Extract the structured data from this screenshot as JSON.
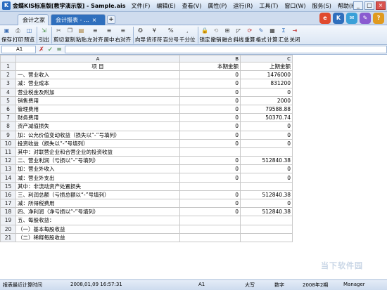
{
  "title": "金蝶KIS标准版[教学演示版] - Sample.ais",
  "menu": [
    "文件(F)",
    "编辑(E)",
    "查看(V)",
    "属性(P)",
    "运行(R)",
    "工具(T)",
    "窗口(W)",
    "服务(S)",
    "帮助(H)"
  ],
  "tabs": [
    {
      "label": "会计之家"
    },
    {
      "label": "会计报表 - ..."
    }
  ],
  "tab_close": "×",
  "tab_add": "+",
  "window_buttons": {
    "min": "_",
    "max": "□",
    "close": "×"
  },
  "skins": [
    {
      "text": "e",
      "color": "#e04a2f"
    },
    {
      "text": "K",
      "color": "#2f6fbd"
    },
    {
      "text": "✉",
      "color": "#3aa0d8"
    },
    {
      "text": "✎",
      "color": "#8a5bd0"
    },
    {
      "text": "?",
      "color": "#e09a1f"
    }
  ],
  "toolbar": [
    {
      "label": "保存",
      "icon": "save-icon",
      "glyph": "▣",
      "color": "#3b6db3"
    },
    {
      "label": "打印",
      "icon": "print-icon",
      "glyph": "⎙",
      "color": "#555"
    },
    {
      "label": "预览",
      "icon": "preview-icon",
      "glyph": "◫",
      "color": "#3b6db3"
    },
    {
      "sep": true
    },
    {
      "label": "引出",
      "icon": "export-icon",
      "glyph": "⇲",
      "color": "#3b8a3b"
    },
    {
      "sep": true
    },
    {
      "label": "剪切",
      "icon": "cut-icon",
      "glyph": "✂",
      "color": "#555"
    },
    {
      "label": "复制",
      "icon": "copy-icon",
      "glyph": "❐",
      "color": "#555"
    },
    {
      "label": "粘贴",
      "icon": "paste-icon",
      "glyph": "▤",
      "color": "#a07020"
    },
    {
      "label": "左对齐",
      "icon": "align-left-icon",
      "glyph": "≡",
      "color": "#333"
    },
    {
      "label": "居中",
      "icon": "align-center-icon",
      "glyph": "≡",
      "color": "#333"
    },
    {
      "label": "右对齐",
      "icon": "align-right-icon",
      "glyph": "≡",
      "color": "#333"
    },
    {
      "sep": true
    },
    {
      "label": "向导",
      "icon": "wizard-icon",
      "glyph": "✪",
      "color": "#555"
    },
    {
      "label": "货币符",
      "icon": "currency-icon",
      "glyph": "¥",
      "color": "#333"
    },
    {
      "label": "百分号",
      "icon": "percent-icon",
      "glyph": "%",
      "color": "#333"
    },
    {
      "label": "千分位",
      "icon": "thousands-icon",
      "glyph": ",",
      "color": "#333"
    },
    {
      "sep": true
    },
    {
      "label": "锁定",
      "icon": "lock-icon",
      "glyph": "🔒",
      "color": "#444"
    },
    {
      "label": "撤销",
      "icon": "undo-icon",
      "glyph": "⟲",
      "color": "#999"
    },
    {
      "label": "融合",
      "icon": "merge-icon",
      "glyph": "⊞",
      "color": "#333"
    },
    {
      "label": "斜线",
      "icon": "diagonal-icon",
      "glyph": "◸",
      "color": "#333"
    },
    {
      "label": "重算",
      "icon": "recalc-icon",
      "glyph": "⟳",
      "color": "#c03030"
    },
    {
      "label": "格式",
      "icon": "format-icon",
      "glyph": "✎",
      "color": "#3b6db3"
    },
    {
      "label": "计算",
      "icon": "calc-icon",
      "glyph": "▦",
      "color": "#333"
    },
    {
      "label": "汇总",
      "icon": "summary-icon",
      "glyph": "Σ",
      "color": "#2f6fbd"
    },
    {
      "label": "关闭",
      "icon": "close-icon",
      "glyph": "⇥",
      "color": "#c03030"
    }
  ],
  "formula": {
    "cell": "A1",
    "cancel": "✗",
    "confirm": "✓",
    "equals": "="
  },
  "grid": {
    "columns": [
      "A",
      "B",
      "C"
    ],
    "rows": [
      {
        "n": "1",
        "a": "项 目",
        "b": "本期金额",
        "c": "上期金额",
        "header": true
      },
      {
        "n": "2",
        "a": "一、营业收入",
        "b": "0",
        "c": "1476000"
      },
      {
        "n": "3",
        "a": "    减：营业成本",
        "b": "0",
        "c": "831200"
      },
      {
        "n": "4",
        "a": "        营业税金及附加",
        "b": "0",
        "c": "0"
      },
      {
        "n": "5",
        "a": "        销售费用",
        "b": "0",
        "c": "2000"
      },
      {
        "n": "6",
        "a": "        管理费用",
        "b": "0",
        "c": "79588.88"
      },
      {
        "n": "7",
        "a": "        财务费用",
        "b": "0",
        "c": "50370.74"
      },
      {
        "n": "8",
        "a": "        资产减值损失",
        "b": "0",
        "c": "0"
      },
      {
        "n": "9",
        "a": "    加：公允价值变动收益（损失以“-”号填列）",
        "b": "0",
        "c": "0"
      },
      {
        "n": "10",
        "a": "        投资收益（损失以“-”号填列）",
        "b": "0",
        "c": "0"
      },
      {
        "n": "11",
        "a": "            其中：对联营企业和合营企业的投资收益",
        "b": "",
        "c": ""
      },
      {
        "n": "12",
        "a": "二、营业利润（亏损以“-”号填列）",
        "b": "0",
        "c": "512840.38"
      },
      {
        "n": "13",
        "a": "    加：营业外收入",
        "b": "0",
        "c": "0"
      },
      {
        "n": "14",
        "a": "    减：营业外支出",
        "b": "0",
        "c": "0"
      },
      {
        "n": "15",
        "a": "        其中：非流动资产处置损失",
        "b": "",
        "c": ""
      },
      {
        "n": "16",
        "a": "三、利润总额（亏损总额以“-”号填列）",
        "b": "0",
        "c": "512840.38"
      },
      {
        "n": "17",
        "a": "    减：所得税费用",
        "b": "0",
        "c": "0"
      },
      {
        "n": "18",
        "a": "四、净利润（净亏损以“-”号填列）",
        "b": "0",
        "c": "512840.38"
      },
      {
        "n": "19",
        "a": "五、每股收益：",
        "b": "",
        "c": ""
      },
      {
        "n": "20",
        "a": "（一）基本每股收益",
        "b": "",
        "c": ""
      },
      {
        "n": "21",
        "a": "（二）稀释每股收益",
        "b": "",
        "c": ""
      }
    ]
  },
  "status": {
    "label": "报表最近计算时间",
    "time": "2008,01,09 16:57:31",
    "cell": "A1",
    "caps": "大写",
    "num": "数字",
    "period": "2008年2期",
    "user": "Manager"
  },
  "watermark": "当下软件园"
}
